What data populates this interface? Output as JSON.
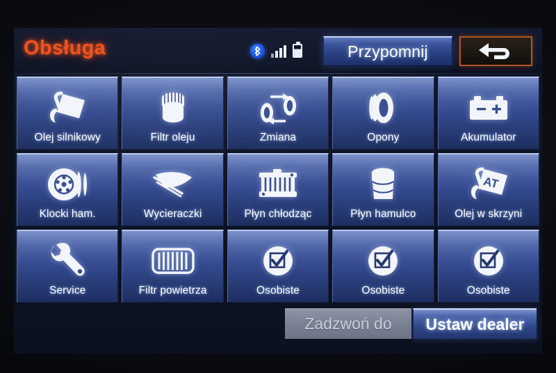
{
  "header": {
    "title": "Obsługa",
    "status_icons": [
      "bluetooth-icon",
      "signal-bars-icon",
      "battery-icon"
    ],
    "remind_label": "Przypomnij",
    "back_icon": "back-arrow-icon"
  },
  "colors": {
    "title": "#f0501a",
    "tile_top": "#6d84c4",
    "tile_bottom": "#1d2e60",
    "accent_border": "#b5561f",
    "disabled_button": "#7c8394"
  },
  "grid": {
    "tiles": [
      {
        "label": "Olej silnikowy",
        "icon": "oil-can-icon"
      },
      {
        "label": "Filtr oleju",
        "icon": "oil-filter-icon"
      },
      {
        "label": "Zmiana",
        "icon": "tire-rotation-icon"
      },
      {
        "label": "Opony",
        "icon": "tire-icon"
      },
      {
        "label": "Akumulator",
        "icon": "battery-terminal-icon"
      },
      {
        "label": "Klocki ham.",
        "icon": "brake-pads-icon"
      },
      {
        "label": "Wycieraczki",
        "icon": "wiper-blade-icon"
      },
      {
        "label": "Płyn chłodząc",
        "icon": "radiator-icon"
      },
      {
        "label": "Płyn hamulco",
        "icon": "brake-fluid-icon"
      },
      {
        "label": "Olej w skrzyni",
        "icon": "transmission-oil-at-icon"
      },
      {
        "label": "Service",
        "icon": "wrench-icon"
      },
      {
        "label": "Filtr powietrza",
        "icon": "air-filter-icon"
      },
      {
        "label": "Osobiste",
        "icon": "checkbox-circle-icon"
      },
      {
        "label": "Osobiste",
        "icon": "checkbox-circle-icon"
      },
      {
        "label": "Osobiste",
        "icon": "checkbox-circle-icon"
      }
    ]
  },
  "footer": {
    "call_label": "Zadzwoń do",
    "dealer_label": "Ustaw dealer"
  }
}
